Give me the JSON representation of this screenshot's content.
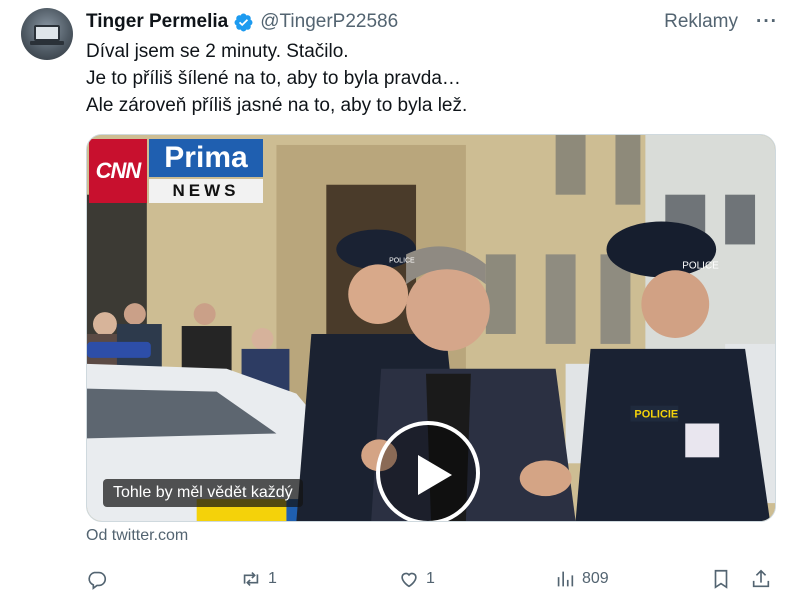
{
  "tweet": {
    "display_name": "Tinger Permelia",
    "handle": "@TingerP22586",
    "ad_label": "Reklamy",
    "more_label": "···",
    "text_lines": [
      "Díval jsem se 2 minuty. Stačilo.",
      "Je to příliš šílené na to, aby to byla pravda…",
      "Ale zároveň příliš jasné na to, aby to byla lež."
    ],
    "source": "Od twitter.com"
  },
  "media": {
    "logo_cnn": "CNN",
    "logo_prima": "Prima",
    "logo_news": "NEWS",
    "caption": "Tohle by měl vědět každý",
    "police_badge": "POLICE",
    "policie_badge": "POLICIE",
    "cap_text": "POLICE"
  },
  "actions": {
    "reply_count": "",
    "retweet_count": "1",
    "like_count": "1",
    "views_count": "809"
  },
  "colors": {
    "verified": "#1d9bf0",
    "secondary_text": "#536471",
    "primary_text": "#0f1419"
  }
}
